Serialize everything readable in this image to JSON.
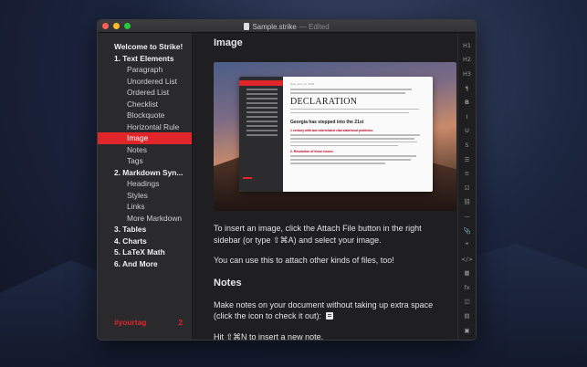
{
  "window": {
    "title": "Sample.strike",
    "status": "— Edited"
  },
  "sidebar": {
    "toc": [
      {
        "label": "Welcome to Strike!",
        "level": 1
      },
      {
        "label": "1. Text Elements",
        "level": 1
      },
      {
        "label": "Paragraph",
        "level": 2
      },
      {
        "label": "Unordered List",
        "level": 2
      },
      {
        "label": "Ordered List",
        "level": 2
      },
      {
        "label": "Checklist",
        "level": 2
      },
      {
        "label": "Blockquote",
        "level": 2
      },
      {
        "label": "Horizontal Rule",
        "level": 2
      },
      {
        "label": "Image",
        "level": 2,
        "active": true
      },
      {
        "label": "Notes",
        "level": 2
      },
      {
        "label": "Tags",
        "level": 2
      },
      {
        "label": "2. Markdown Syn...",
        "level": 1
      },
      {
        "label": "Headings",
        "level": 2
      },
      {
        "label": "Styles",
        "level": 2
      },
      {
        "label": "Links",
        "level": 2
      },
      {
        "label": "More Markdown",
        "level": 2
      },
      {
        "label": "3. Tables",
        "level": 1
      },
      {
        "label": "4. Charts",
        "level": 1
      },
      {
        "label": "5. LaTeX Math",
        "level": 1
      },
      {
        "label": "6. And More",
        "level": 1
      }
    ],
    "tag": {
      "label": "#yourtag",
      "count": "2"
    }
  },
  "editor": {
    "image_heading": "Image",
    "screenshot": {
      "date": "Date June 13, 2006",
      "heading": "DECLARATION",
      "subheading": "Georgia has stepped into the 21st",
      "section1": "1 century with two interrelated vital statehood problems:",
      "section2": "2. Resolution of these issues"
    },
    "para1": "To insert an image, click the Attach File button in the right sidebar (or type ⇧⌘A) and select your image.",
    "para2": "You can use this to attach other kinds of files, too!",
    "notes_heading": "Notes",
    "para3": "Make notes on your document without taking up extra space (click the icon to check it out):",
    "para4": "Hit ⇧⌘N to insert a new note."
  },
  "toolbar": {
    "items": [
      {
        "label": "H1",
        "icon": "heading1-icon"
      },
      {
        "label": "H2",
        "icon": "heading2-icon"
      },
      {
        "label": "H3",
        "icon": "heading3-icon"
      },
      {
        "label": "¶",
        "icon": "paragraph-icon"
      },
      {
        "label": "B",
        "icon": "bold-icon"
      },
      {
        "label": "I",
        "icon": "italic-icon"
      },
      {
        "label": "U",
        "icon": "underline-icon"
      },
      {
        "label": "S",
        "icon": "strikethrough-icon"
      },
      {
        "label": "☰",
        "icon": "unordered-list-icon"
      },
      {
        "label": "≡",
        "icon": "ordered-list-icon"
      },
      {
        "label": "☑",
        "icon": "checklist-icon"
      },
      {
        "label": "⛓",
        "icon": "link-icon"
      },
      {
        "label": "—",
        "icon": "horizontal-rule-icon"
      },
      {
        "label": "📎",
        "icon": "attach-file-icon"
      },
      {
        "label": "❝",
        "icon": "blockquote-icon"
      },
      {
        "label": "</>",
        "icon": "code-icon"
      },
      {
        "label": "▦",
        "icon": "table-icon"
      },
      {
        "label": "fx",
        "icon": "math-icon"
      },
      {
        "label": "◫",
        "icon": "chart-icon"
      },
      {
        "label": "▤",
        "icon": "note-icon"
      },
      {
        "label": "▣",
        "icon": "more-icon"
      }
    ]
  }
}
